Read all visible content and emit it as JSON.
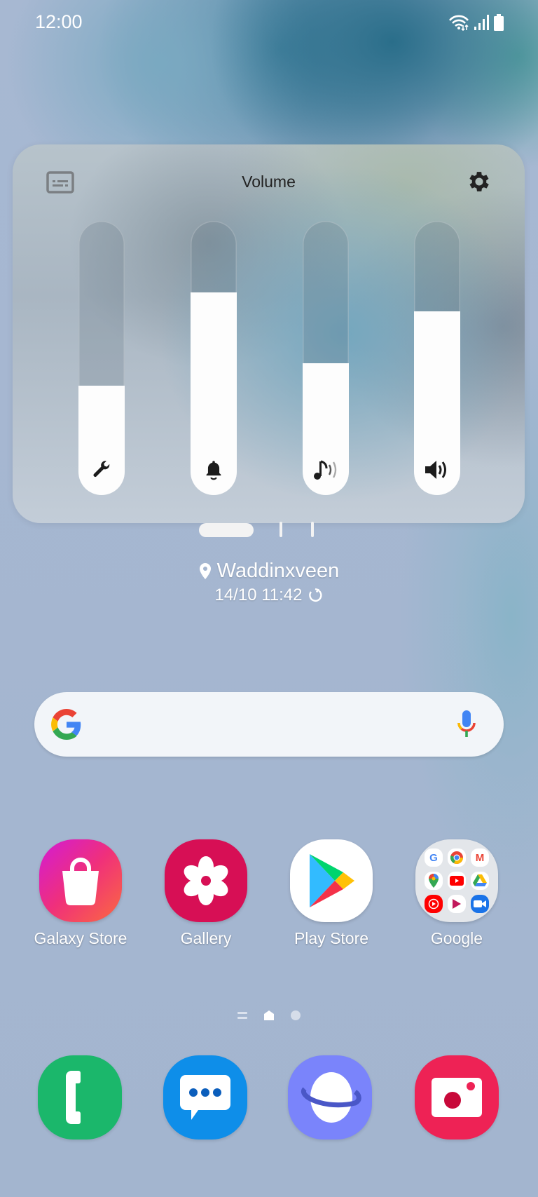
{
  "status_bar": {
    "time": "12:00",
    "icons": [
      "wifi-data-icon",
      "signal-icon",
      "battery-icon"
    ]
  },
  "volume_panel": {
    "title": "Volume",
    "caption_icon": "live-caption-icon",
    "settings_icon": "gear-icon",
    "sliders": [
      {
        "name": "system",
        "icon": "wrench-icon",
        "level": 0.4
      },
      {
        "name": "ringtone",
        "icon": "bell-icon",
        "level": 0.74
      },
      {
        "name": "media",
        "icon": "music-note-icon",
        "level": 0.48
      },
      {
        "name": "notifications",
        "icon": "speaker-icon",
        "level": 0.67
      }
    ]
  },
  "weather": {
    "location": "Waddinxveen",
    "updated": "14/10 11:42"
  },
  "search": {
    "placeholder": "",
    "logo": "google-logo",
    "mic_icon": "mic-icon"
  },
  "apps": [
    {
      "label": "Galaxy Store",
      "icon": "shopping-bag-icon",
      "color": "#e8327a"
    },
    {
      "label": "Gallery",
      "icon": "flower-icon",
      "color": "#d70f55"
    },
    {
      "label": "Play Store",
      "icon": "play-triangle-icon",
      "color": "#ffffff"
    },
    {
      "label": "Google",
      "icon": "folder-icon",
      "color": "#e3e6ea"
    }
  ],
  "folder_contents": [
    "G",
    "Chrome",
    "Gmail",
    "Maps",
    "YouTube",
    "Drive",
    "YT Music",
    "Play Movies",
    "Duo"
  ],
  "page_indicator": {
    "pages": 2,
    "current": 0
  },
  "dock": [
    {
      "name": "phone",
      "icon": "phone-icon",
      "color": "#1bb76b"
    },
    {
      "name": "messages",
      "icon": "chat-bubble-icon",
      "color": "#0e8ee9"
    },
    {
      "name": "internet",
      "icon": "planet-icon",
      "color": "#7a84fb"
    },
    {
      "name": "camera",
      "icon": "camera-icon",
      "color": "#ee2255"
    }
  ]
}
